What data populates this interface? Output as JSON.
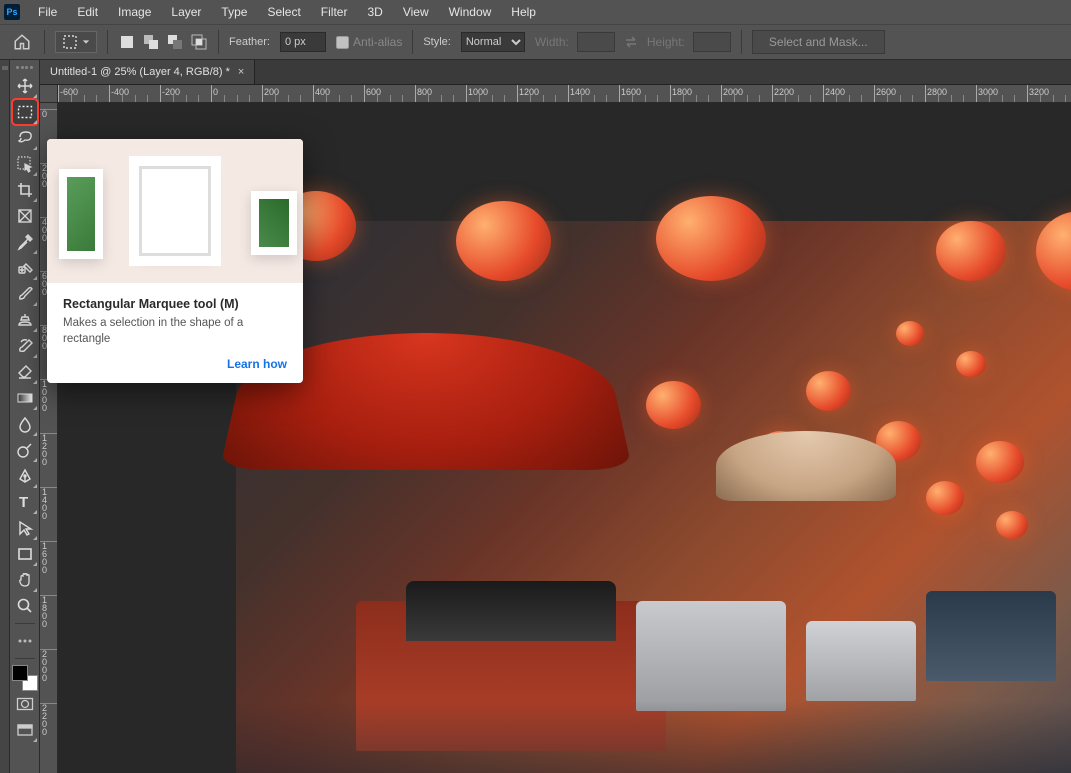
{
  "menu": [
    "File",
    "Edit",
    "Image",
    "Layer",
    "Type",
    "Select",
    "Filter",
    "3D",
    "View",
    "Window",
    "Help"
  ],
  "options": {
    "feather_label": "Feather:",
    "feather_value": "0 px",
    "antialias": "Anti-alias",
    "style_label": "Style:",
    "style_value": "Normal",
    "width_label": "Width:",
    "height_label": "Height:",
    "mask_btn": "Select and Mask..."
  },
  "tab": {
    "title": "Untitled-1 @ 25% (Layer 4, RGB/8) *"
  },
  "ruler": {
    "top_ticks": [
      -600,
      -400,
      -200,
      0,
      200,
      400,
      600,
      800,
      1000,
      1200,
      1400,
      1600,
      1800,
      2000,
      2200,
      2400,
      2600,
      2800,
      3000,
      3200
    ],
    "left_ticks": [
      0,
      200,
      400,
      600,
      800,
      1000,
      1200,
      1400,
      1600,
      1800,
      2000,
      2200
    ]
  },
  "tooltip": {
    "title": "Rectangular Marquee tool (M)",
    "desc": "Makes a selection in the shape of a rectangle",
    "link": "Learn how"
  },
  "tools": [
    {
      "name": "move-tool",
      "shortcut": "V"
    },
    {
      "name": "rectangular-marquee-tool",
      "shortcut": "M",
      "selected": true
    },
    {
      "name": "lasso-tool",
      "shortcut": "L"
    },
    {
      "name": "object-selection-tool",
      "shortcut": "W"
    },
    {
      "name": "crop-tool",
      "shortcut": "C"
    },
    {
      "name": "frame-tool",
      "shortcut": "K"
    },
    {
      "name": "eyedropper-tool",
      "shortcut": "I"
    },
    {
      "name": "spot-healing-brush-tool",
      "shortcut": "J"
    },
    {
      "name": "brush-tool",
      "shortcut": "B"
    },
    {
      "name": "clone-stamp-tool",
      "shortcut": "S"
    },
    {
      "name": "history-brush-tool",
      "shortcut": "Y"
    },
    {
      "name": "eraser-tool",
      "shortcut": "E"
    },
    {
      "name": "gradient-tool",
      "shortcut": "G"
    },
    {
      "name": "blur-tool"
    },
    {
      "name": "dodge-tool",
      "shortcut": "O"
    },
    {
      "name": "pen-tool",
      "shortcut": "P"
    },
    {
      "name": "horizontal-type-tool",
      "shortcut": "T"
    },
    {
      "name": "path-selection-tool",
      "shortcut": "A"
    },
    {
      "name": "rectangle-tool",
      "shortcut": "U"
    },
    {
      "name": "hand-tool",
      "shortcut": "H"
    },
    {
      "name": "zoom-tool",
      "shortcut": "Z"
    }
  ]
}
